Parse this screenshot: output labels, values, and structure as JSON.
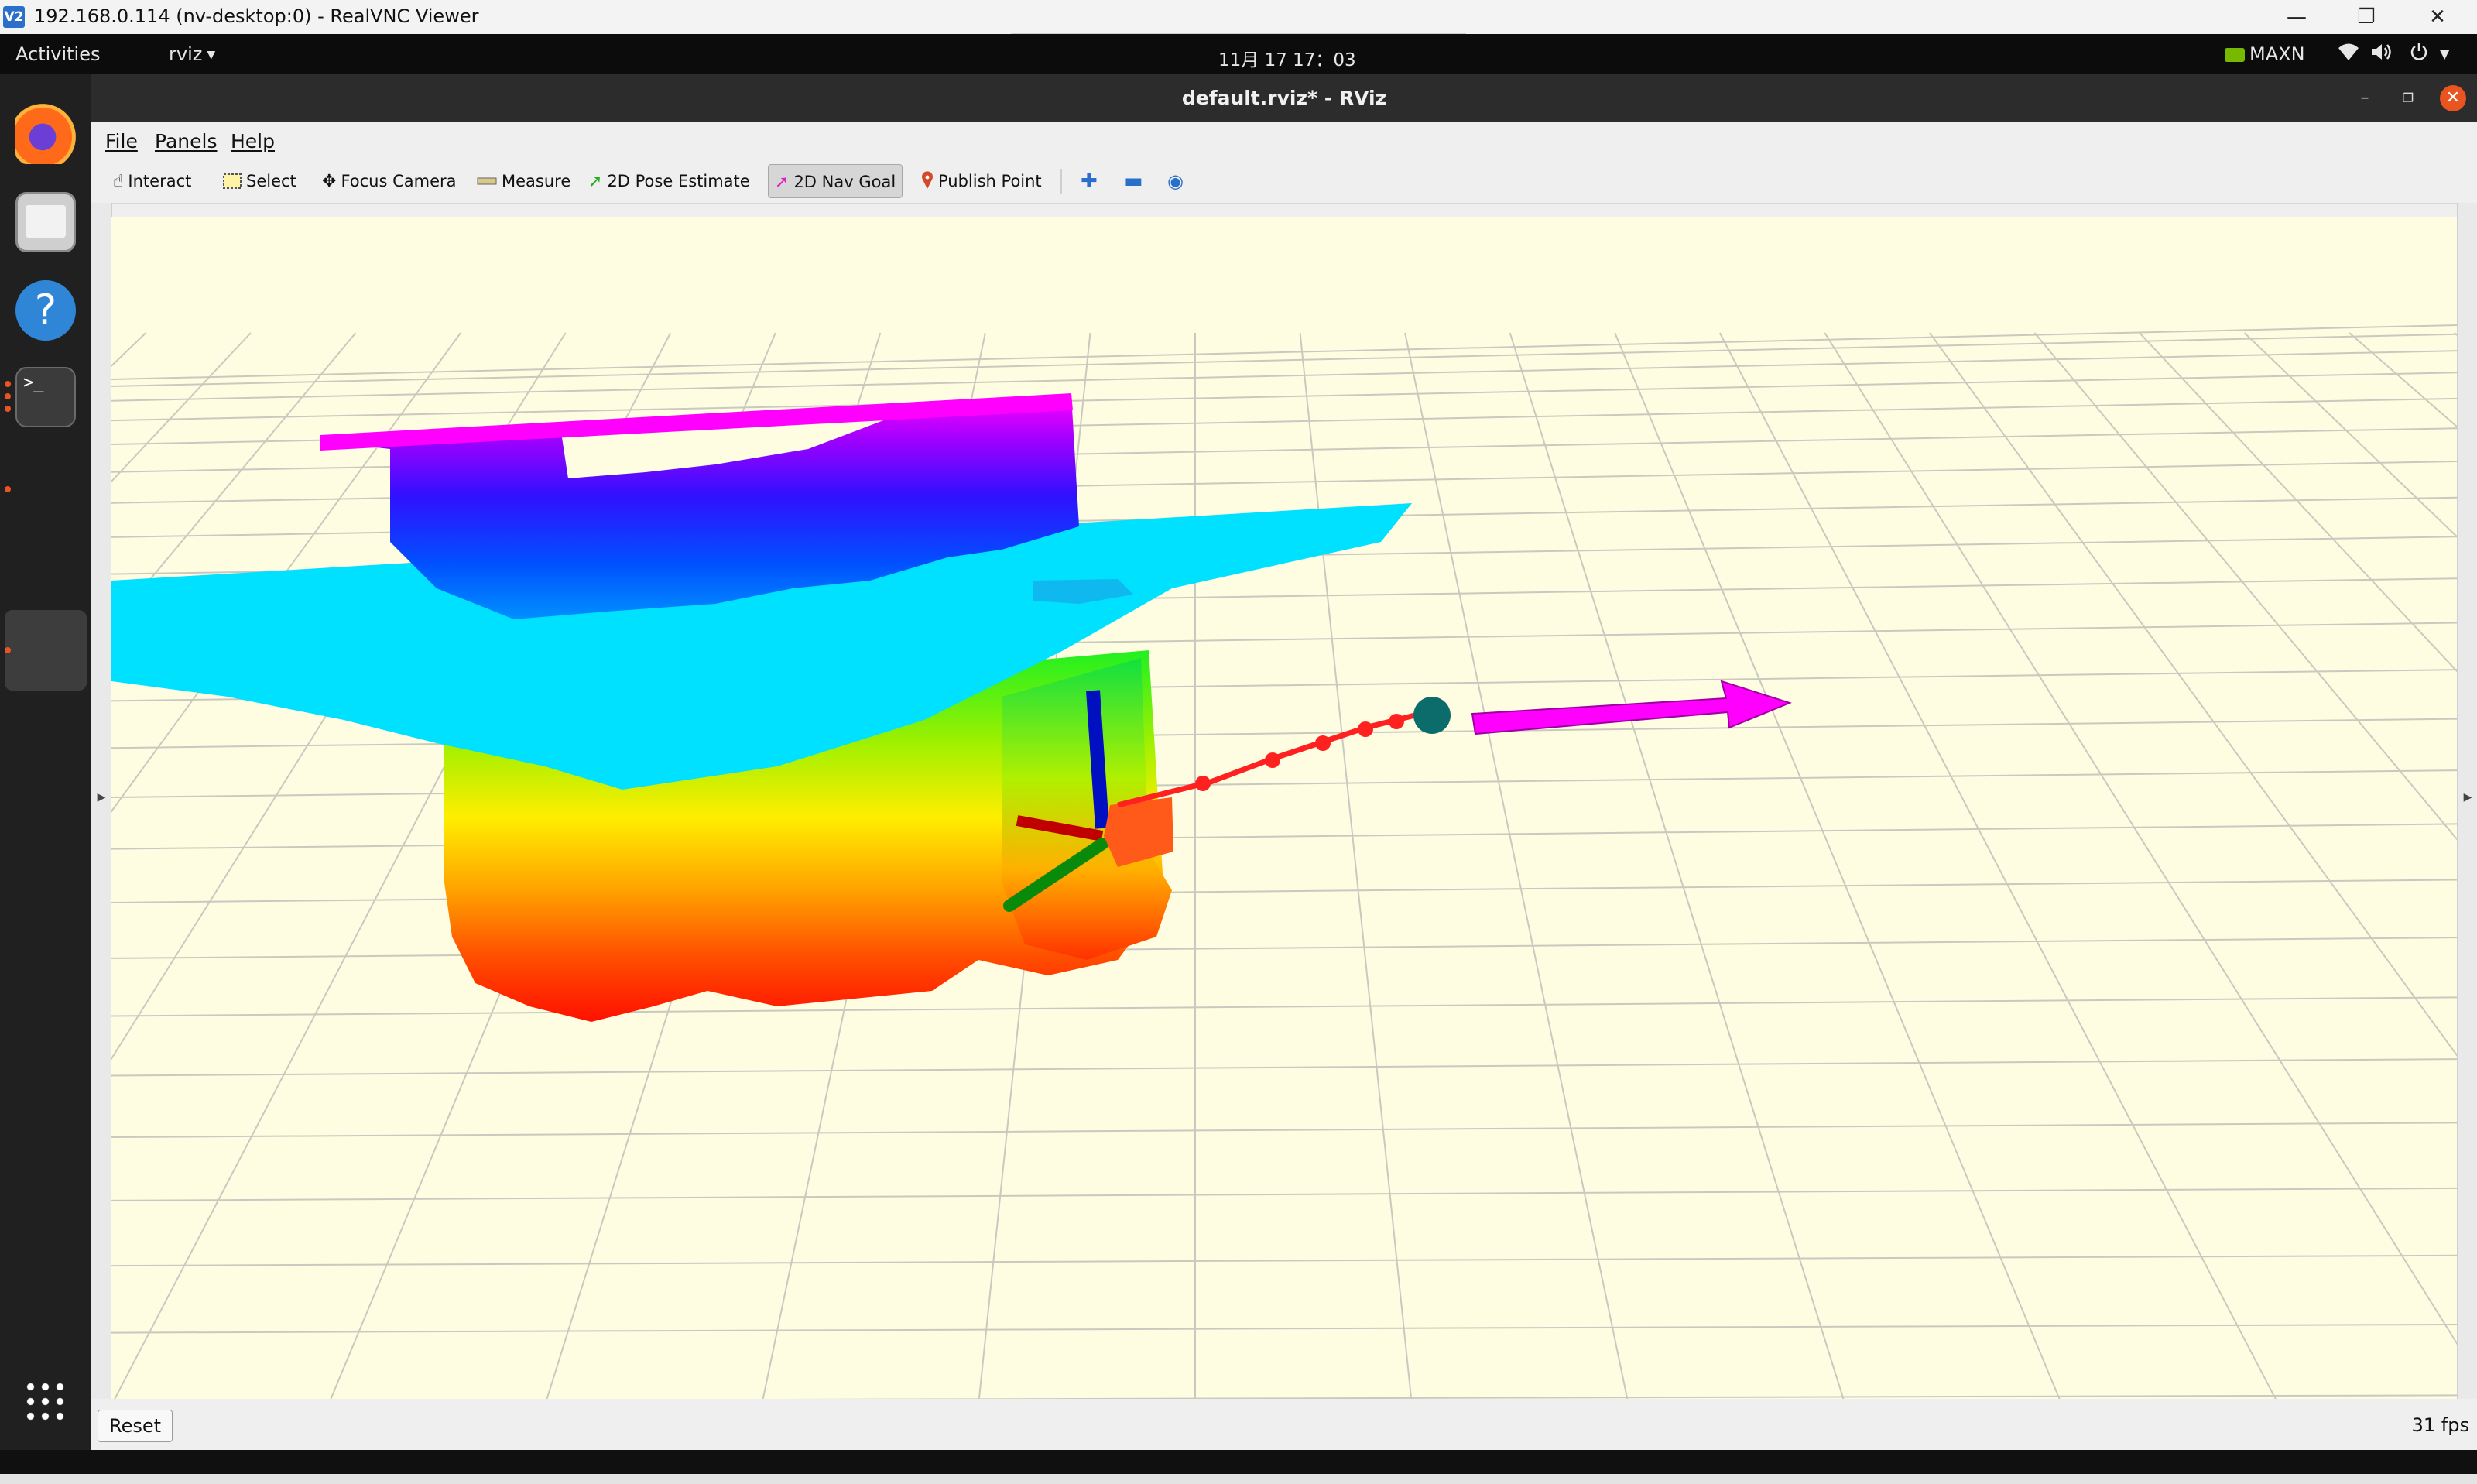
{
  "vnc": {
    "app_icon": "V2",
    "title": "192.168.0.114 (nv-desktop:0) - RealVNC Viewer",
    "minimize": "—",
    "maximize": "❐",
    "close": "✕"
  },
  "topbar": {
    "activities": "Activities",
    "app_menu": "rviz",
    "clock": "11月 17  17：03",
    "power_mode": "MAXN",
    "icons": [
      "wifi-icon",
      "volume-icon",
      "power-icon",
      "chevron-down-icon"
    ]
  },
  "dock": {
    "apps": [
      "firefox-icon",
      "files-icon",
      "help-icon",
      "terminal-icon",
      "rviz-window-icon"
    ],
    "help_glyph": "?",
    "terminal_glyph": ">_",
    "show_apps": "grid-icon"
  },
  "rviz": {
    "window_title": "default.rviz* - RViz",
    "menu": [
      "File",
      "Panels",
      "Help"
    ],
    "tools": [
      {
        "label": "Interact",
        "icon": "hand-icon"
      },
      {
        "label": "Select",
        "icon": "select-box-icon"
      },
      {
        "label": "Focus Camera",
        "icon": "crosshair-icon"
      },
      {
        "label": "Measure",
        "icon": "ruler-icon"
      },
      {
        "label": "2D Pose Estimate",
        "icon": "green-arrow-icon"
      },
      {
        "label": "2D Nav Goal",
        "icon": "pink-arrow-icon",
        "active": true
      },
      {
        "label": "Publish Point",
        "icon": "map-pin-icon"
      }
    ],
    "tool_extras": [
      "plus-icon",
      "minus-icon",
      "eye-icon"
    ],
    "reset_label": "Reset",
    "fps": "31 fps"
  },
  "colors": {
    "viewport_bg": "#fefde1",
    "grid": "#c8c8c0",
    "map_plane": "#00e0ff",
    "nav_goal_arrow": "#ff00ff",
    "path": "#ff2020",
    "axis_x": "#e00000",
    "axis_y": "#009000",
    "axis_z": "#0010c0",
    "goal_sphere": "#0c6b6b"
  }
}
